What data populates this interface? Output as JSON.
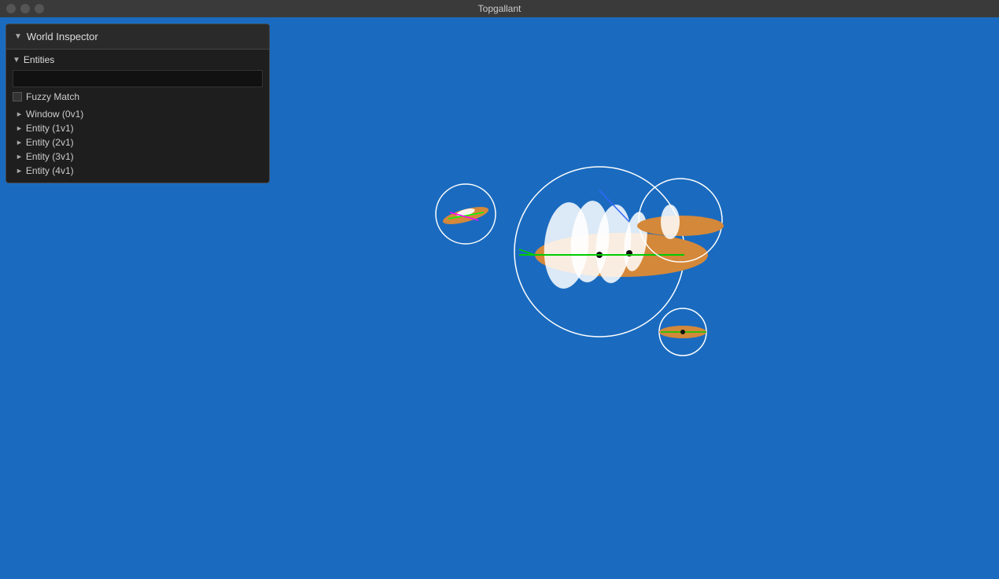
{
  "titlebar": {
    "title": "Topgallant"
  },
  "inspector": {
    "title": "World Inspector",
    "header_arrow": "▼",
    "entities_label": "Entities",
    "entities_arrow": "▼",
    "search_placeholder": "",
    "fuzzy_label": "Fuzzy Match",
    "items": [
      {
        "label": "Window (0v1)",
        "arrow": "►"
      },
      {
        "label": "Entity (1v1)",
        "arrow": "►"
      },
      {
        "label": "Entity (2v1)",
        "arrow": "►"
      },
      {
        "label": "Entity (3v1)",
        "arrow": "►"
      },
      {
        "label": "Entity (4v1)",
        "arrow": "►"
      }
    ]
  },
  "canvas": {
    "background": "#1a6bbf"
  }
}
